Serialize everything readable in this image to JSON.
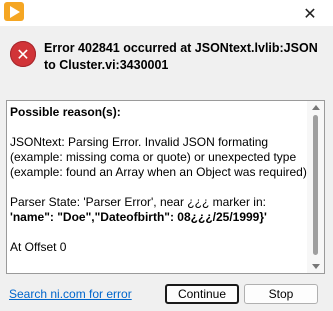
{
  "window": {
    "app_icon": "labview-app-icon",
    "close_glyph": "✕"
  },
  "message": {
    "icon": "error-icon",
    "icon_glyph": "✕",
    "headline": "Error 402841 occurred at JSONtext.lvlib:JSON to Cluster.vi:3430001"
  },
  "details": {
    "title": "Possible reason(s):",
    "line1": "JSONtext: Parsing Error.  Invalid JSON formating (example: missing coma or quote) or unexpected type (example: found an Array when an Object was required)",
    "line2": "Parser State: 'Parser Error', near ¿¿¿ marker in:",
    "line3": "'name\": \"Doe\",\"Dateofbirth\": 08¿¿¿/25/1999}'",
    "line4": "At Offset 0"
  },
  "footer": {
    "link_label": "Search ni.com for error",
    "continue_label": "Continue",
    "stop_label": "Stop"
  }
}
